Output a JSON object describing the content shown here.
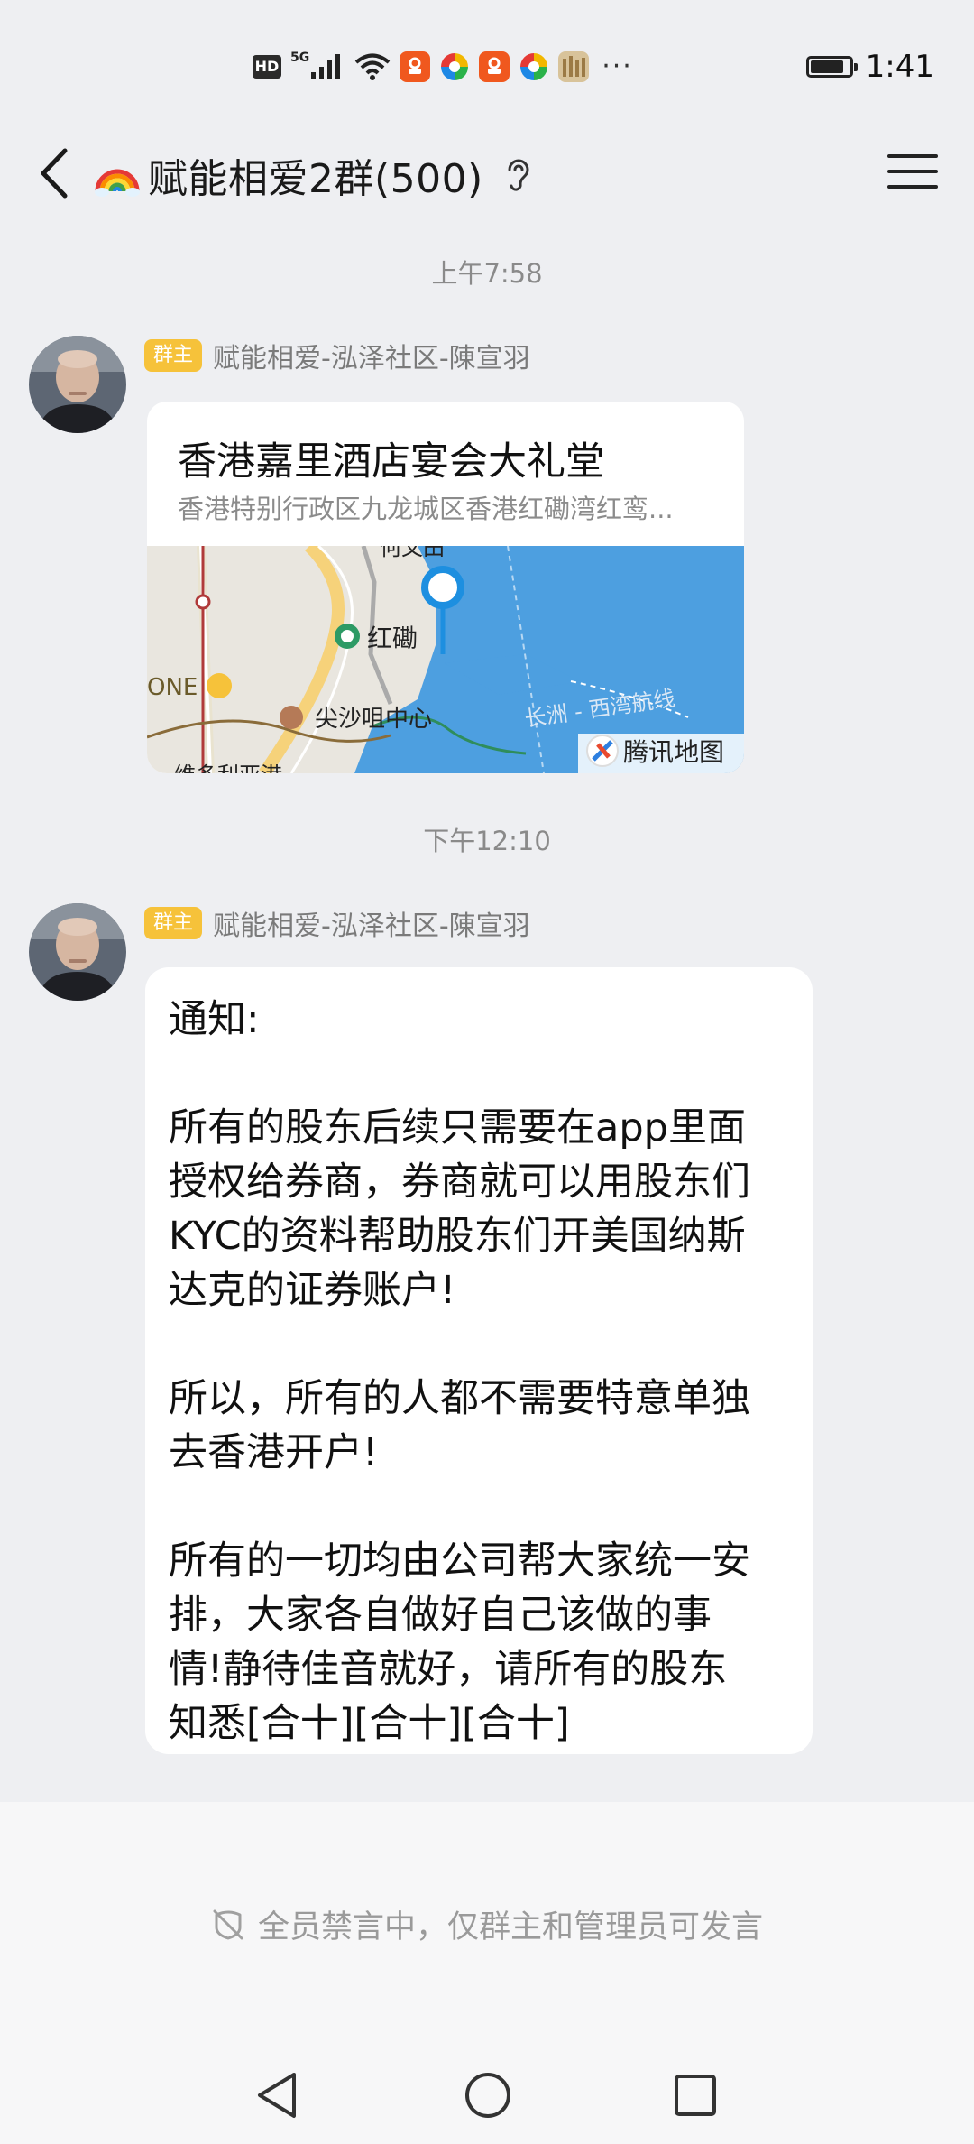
{
  "status_bar": {
    "time": "1:41",
    "hd_label": "HD",
    "network_label": "5G",
    "more_label": "···",
    "icons": [
      "hd-icon",
      "signal-icon",
      "wifi-icon",
      "app-notification-icon",
      "browser-icon",
      "app-notification-icon",
      "browser-icon",
      "app-icon",
      "battery-icon"
    ]
  },
  "header": {
    "title": "赋能相爱2群(500)",
    "back_icon": "back-arrow-icon",
    "title_emoji": "rainbow-icon",
    "ear_icon": "ear-icon",
    "menu_icon": "menu-icon"
  },
  "messages": [
    {
      "time": "上午7:58",
      "badge": "群主",
      "sender": "赋能相爱-泓泽社区-陳宣羽",
      "type": "location",
      "location_title": "香港嘉里酒店宴会大礼堂",
      "location_address": "香港特别行政区九龙城区香港红磡湾红鸾...",
      "map_labels": {
        "station": "红磡",
        "center": "尖沙咀中心",
        "route": "长洲 - 西湾航线",
        "provider": "腾讯地图",
        "one": "ONE",
        "top_partial": "何文田",
        "bottom_partial": "维多利亚港"
      }
    },
    {
      "time": "下午12:10",
      "badge": "群主",
      "sender": "赋能相爱-泓泽社区-陳宣羽",
      "type": "text",
      "lines": [
        "通知:",
        "",
        "所有的股东后续只需要在app里面",
        "授权给券商，券商就可以用股东们",
        "KYC的资料帮助股东们开美国纳斯",
        "达克的证券账户!",
        "",
        "所以，所有的人都不需要特意单独",
        "去香港开户!",
        "",
        "所有的一切均由公司帮大家统一安",
        "排，大家各自做好自己该做的事",
        "情!静待佳音就好，请所有的股东",
        "知悉[合十][合十][合十]"
      ]
    }
  ],
  "footer": {
    "muted_text": "全员禁言中，仅群主和管理员可发言",
    "muted_icon": "mute-icon"
  },
  "nav_bar": {
    "icons": [
      "nav-back-icon",
      "nav-home-icon",
      "nav-recents-icon"
    ]
  },
  "colors": {
    "background": "#eeeff2",
    "bubble": "#ffffff",
    "owner_badge": "#f6c23a",
    "map_pin": "#1d8fe0",
    "map_water": "#4d9fe0"
  }
}
